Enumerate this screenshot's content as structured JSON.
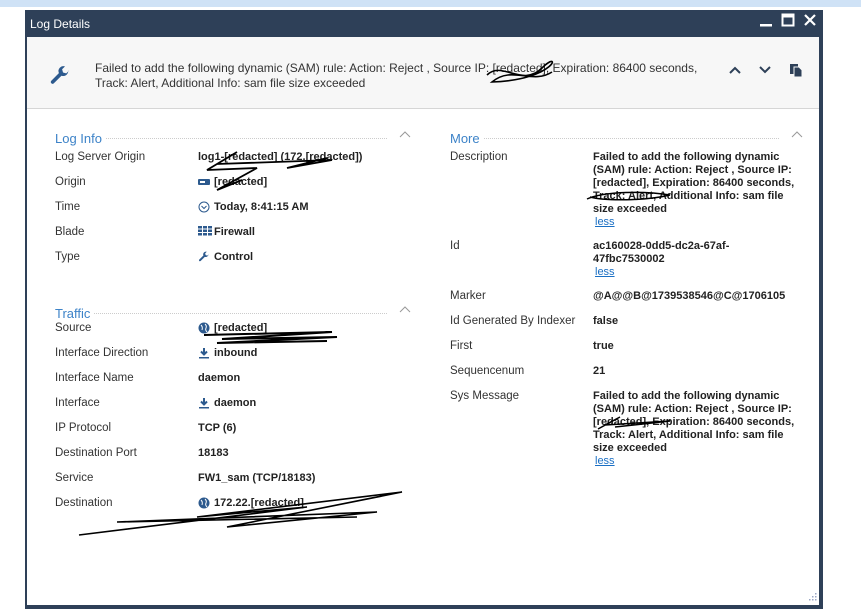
{
  "window": {
    "title": "Log Details",
    "minimize_label": "_",
    "maximize_label": "□",
    "close_label": "✕"
  },
  "header": {
    "icon": "wrench-icon",
    "message_line1": "Failed to add the following dynamic (SAM) rule: Action: Reject , Source IP: [redacted], Expiration: 86400 seconds,",
    "message_line2": "Track: Alert, Additional Info: sam file size exceeded",
    "buttons": [
      "previous",
      "next",
      "copy"
    ]
  },
  "log_info": {
    "title": "Log Info",
    "rows": [
      {
        "label": "Log Server Origin",
        "value": "log1-[redacted] (172.[redacted])",
        "icon": ""
      },
      {
        "label": "Origin",
        "value": "[redacted]",
        "icon": "gateway-icon"
      },
      {
        "label": "Time",
        "value": "Today, 8:41:15 AM",
        "icon": "clock-icon"
      },
      {
        "label": "Blade",
        "value": "Firewall",
        "icon": "firewall-icon"
      },
      {
        "label": "Type",
        "value": "Control",
        "icon": "wrench-icon"
      }
    ]
  },
  "traffic": {
    "title": "Traffic",
    "rows": [
      {
        "label": "Source",
        "value": "[redacted]",
        "icon": "globe-icon"
      },
      {
        "label": "Interface Direction",
        "value": "inbound",
        "icon": "download-arrow-icon"
      },
      {
        "label": "Interface Name",
        "value": "daemon",
        "icon": ""
      },
      {
        "label": "Interface",
        "value": "daemon",
        "icon": "download-arrow-icon"
      },
      {
        "label": "IP Protocol",
        "value": "TCP (6)",
        "icon": ""
      },
      {
        "label": "Destination Port",
        "value": "18183",
        "icon": ""
      },
      {
        "label": "Service",
        "value": "FW1_sam (TCP/18183)",
        "icon": ""
      },
      {
        "label": "Destination",
        "value": "172.22.[redacted]",
        "icon": "globe-icon"
      }
    ]
  },
  "more": {
    "title": "More",
    "less_label": "less",
    "rows": [
      {
        "label": "Description",
        "value": "Failed to add the following dynamic (SAM) rule: Action: Reject , Source IP: [redacted], Expiration: 86400 seconds, Track: Alert, Additional Info: sam file size exceeded",
        "less": true
      },
      {
        "label": "Id",
        "value": "ac160028-0dd5-dc2a-67af-47fbc7530002",
        "less": true
      },
      {
        "label": "Marker",
        "value": "@A@@B@1739538546@C@1706105",
        "less": false
      },
      {
        "label": "Id Generated By Indexer",
        "value": "false",
        "less": false
      },
      {
        "label": "First",
        "value": "true",
        "less": false
      },
      {
        "label": "Sequencenum",
        "value": "21",
        "less": false
      },
      {
        "label": "Sys Message",
        "value": "Failed to add the following dynamic (SAM) rule: Action: Reject , Source IP: [redacted], Expiration: 86400 seconds, Track: Alert, Additional Info: sam file size exceeded",
        "less": true
      }
    ]
  },
  "colors": {
    "frame": "#2e4058",
    "accent": "#3d83c8",
    "icon": "#2d5a8e",
    "link": "#1a6fc4"
  }
}
